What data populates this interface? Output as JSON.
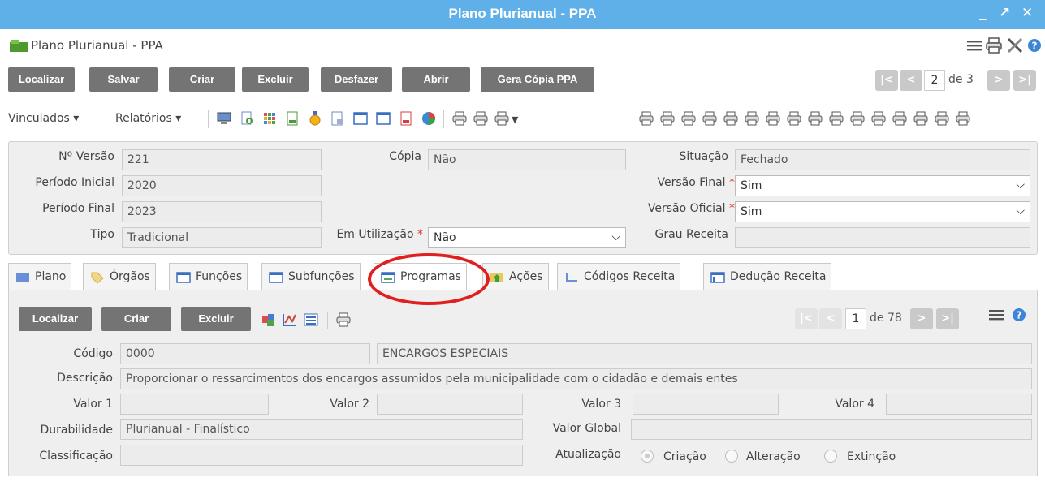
{
  "window": {
    "title": "Plano Plurianual - PPA",
    "minimize": "_",
    "maximize": "↗",
    "close": "✕"
  },
  "header": {
    "app_title": "Plano Plurianual - PPA"
  },
  "main_toolbar": {
    "buttons": [
      "Localizar",
      "Salvar",
      "Criar",
      "Excluir",
      "Desfazer",
      "Abrir",
      "Gera Cópia PPA"
    ],
    "pager": {
      "first": "|<",
      "prev": "<",
      "current": "2",
      "of_label": "de 3",
      "next": ">",
      "last": ">|"
    }
  },
  "secondary_toolbar": {
    "vinculados": "Vinculados ▾",
    "relatorios": "Relatórios ▾"
  },
  "form": {
    "versao_label": "Nº Versão",
    "versao_value": "221",
    "periodo_inicial_label": "Período Inicial",
    "periodo_inicial_value": "2020",
    "periodo_final_label": "Período Final",
    "periodo_final_value": "2023",
    "tipo_label": "Tipo",
    "tipo_value": "Tradicional",
    "copia_label": "Cópia",
    "copia_value": "Não",
    "em_utilizacao_label": "Em Utilização",
    "em_utilizacao_value": "Não",
    "situacao_label": "Situação",
    "situacao_value": "Fechado",
    "versao_final_label": "Versão Final",
    "versao_final_value": "Sim",
    "versao_oficial_label": "Versão Oficial",
    "versao_oficial_value": "Sim",
    "grau_receita_label": "Grau Receita",
    "grau_receita_value": "",
    "required_mark": "*"
  },
  "tabs": [
    {
      "label": "Plano"
    },
    {
      "label": "Órgãos"
    },
    {
      "label": "Funções"
    },
    {
      "label": "Subfunções"
    },
    {
      "label": "Programas"
    },
    {
      "label": "Ações"
    },
    {
      "label": "Códigos Receita"
    },
    {
      "label": "Dedução Receita"
    }
  ],
  "programas": {
    "buttons": [
      "Localizar",
      "Criar",
      "Excluir"
    ],
    "pager": {
      "first": "|<",
      "prev": "<",
      "current": "1",
      "of_label": "de 78",
      "next": ">",
      "last": ">|"
    },
    "codigo_label": "Código",
    "codigo_value": "0000",
    "codigo_nome": "ENCARGOS ESPECIAIS",
    "descricao_label": "Descrição",
    "descricao_value": "Proporcionar o ressarcimentos dos encargos assumidos pela municipalidade com o cidadão e demais entes",
    "valor1_label": "Valor 1",
    "valor2_label": "Valor 2",
    "valor3_label": "Valor 3",
    "valor4_label": "Valor 4",
    "durabilidade_label": "Durabilidade",
    "durabilidade_value": "Plurianual - Finalístico",
    "valor_global_label": "Valor Global",
    "classificacao_label": "Classificação",
    "atualizacao_label": "Atualização",
    "radio_options": [
      "Criação",
      "Alteração",
      "Extinção"
    ]
  }
}
